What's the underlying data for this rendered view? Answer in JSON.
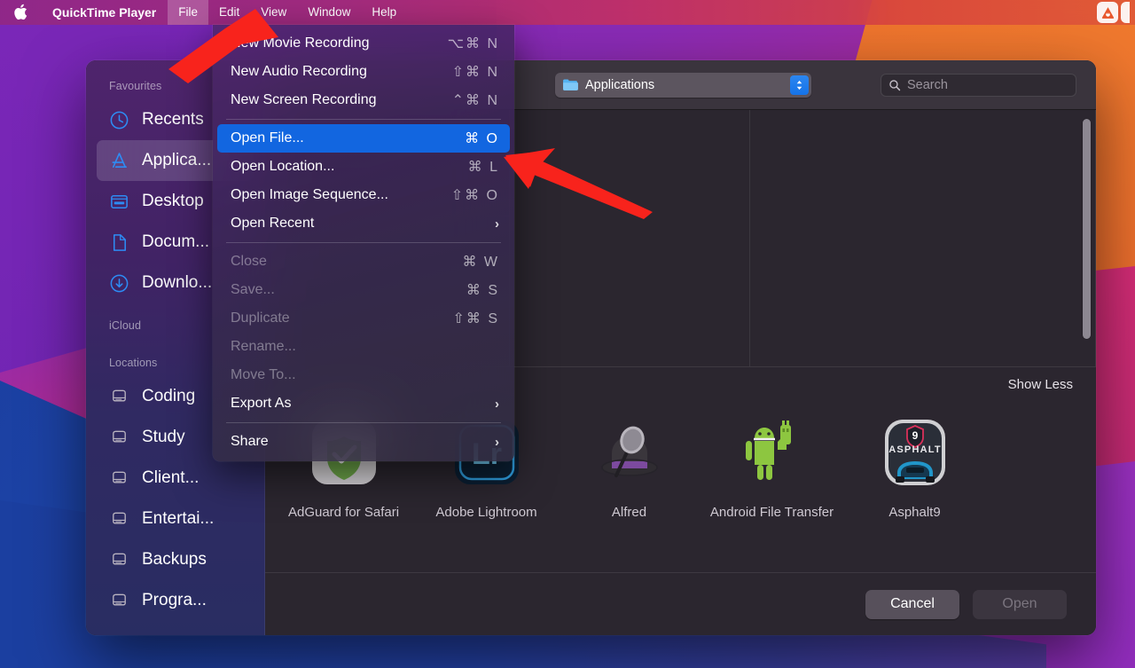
{
  "menubar": {
    "apple_icon": "apple-logo-icon",
    "app_title": "QuickTime Player",
    "items": [
      {
        "label": "File",
        "active": true
      },
      {
        "label": "Edit",
        "active": false
      },
      {
        "label": "View",
        "active": false
      },
      {
        "label": "Window",
        "active": false
      },
      {
        "label": "Help",
        "active": false
      }
    ],
    "status_icons": [
      "adguard-icon",
      "partial-status-icon"
    ]
  },
  "file_menu": {
    "groups": [
      [
        {
          "label": "New Movie Recording",
          "shortcut": "⌥⌘ N",
          "state": "enabled"
        },
        {
          "label": "New Audio Recording",
          "shortcut": "⇧⌘ N",
          "state": "enabled"
        },
        {
          "label": "New Screen Recording",
          "shortcut": "⌃⌘ N",
          "state": "enabled"
        }
      ],
      [
        {
          "label": "Open File...",
          "shortcut": "⌘ O",
          "state": "selected"
        },
        {
          "label": "Open Location...",
          "shortcut": "⌘ L",
          "state": "enabled"
        },
        {
          "label": "Open Image Sequence...",
          "shortcut": "⇧⌘ O",
          "state": "enabled"
        },
        {
          "label": "Open Recent",
          "shortcut": "",
          "submenu": true,
          "state": "enabled"
        }
      ],
      [
        {
          "label": "Close",
          "shortcut": "⌘ W",
          "state": "disabled"
        },
        {
          "label": "Save...",
          "shortcut": "⌘ S",
          "state": "disabled"
        },
        {
          "label": "Duplicate",
          "shortcut": "⇧⌘ S",
          "state": "disabled"
        },
        {
          "label": "Rename...",
          "shortcut": "",
          "state": "disabled"
        },
        {
          "label": "Move To...",
          "shortcut": "",
          "state": "disabled"
        },
        {
          "label": "Export As",
          "shortcut": "",
          "submenu": true,
          "state": "enabled"
        }
      ],
      [
        {
          "label": "Share",
          "shortcut": "",
          "submenu": true,
          "state": "enabled"
        }
      ]
    ]
  },
  "dialog": {
    "sidebar": {
      "groups": [
        {
          "header": "Favourites",
          "items": [
            {
              "label": "Recents",
              "icon": "clock-icon",
              "selected": false
            },
            {
              "label": "Applica...",
              "icon": "applications-icon",
              "selected": true
            },
            {
              "label": "Desktop",
              "icon": "desktop-icon",
              "selected": false
            },
            {
              "label": "Docum...",
              "icon": "document-icon",
              "selected": false
            },
            {
              "label": "Downlo...",
              "icon": "downloads-icon",
              "selected": false
            }
          ]
        },
        {
          "header": "iCloud",
          "items": []
        },
        {
          "header": "Locations",
          "items": [
            {
              "label": "Coding",
              "icon": "drive-icon",
              "selected": false
            },
            {
              "label": "Study",
              "icon": "drive-icon",
              "selected": false
            },
            {
              "label": "Client...",
              "icon": "drive-icon",
              "selected": false
            },
            {
              "label": "Entertai...",
              "icon": "drive-icon",
              "selected": false
            },
            {
              "label": "Backups",
              "icon": "drive-icon",
              "selected": false
            },
            {
              "label": "Progra...",
              "icon": "drive-icon",
              "selected": false
            }
          ]
        }
      ]
    },
    "toolbar": {
      "path_popup_label": "Applications",
      "path_popup_icon": "folder-icon",
      "search_placeholder": "Search",
      "search_value": "",
      "search_icon": "search-icon"
    },
    "show_less_label": "Show Less",
    "apps": [
      {
        "name": "AdGuard for Safari",
        "icon": "adguard-app-icon"
      },
      {
        "name": "Adobe Lightroom",
        "icon": "lightroom-app-icon"
      },
      {
        "name": "Alfred",
        "icon": "alfred-app-icon"
      },
      {
        "name": "Android File Transfer",
        "icon": "android-app-icon"
      },
      {
        "name": "Asphalt9",
        "icon": "asphalt9-app-icon"
      }
    ],
    "footer": {
      "cancel_label": "Cancel",
      "open_label": "Open",
      "open_disabled": true
    }
  },
  "annotations": {
    "arrow_color": "#F8231C",
    "arrows": [
      {
        "name": "arrow-to-file-menu",
        "points_to": "File"
      },
      {
        "name": "arrow-to-open-file-item",
        "points_to": "Open File..."
      }
    ]
  },
  "colors": {
    "menu_highlight": "#1266E0",
    "sidebar_selected": "rgba(255,255,255,0.15)",
    "dialog_bg": "#2B262F",
    "toolbar_bg": "#3A343D",
    "stepper_blue": "#1C7AEC"
  }
}
